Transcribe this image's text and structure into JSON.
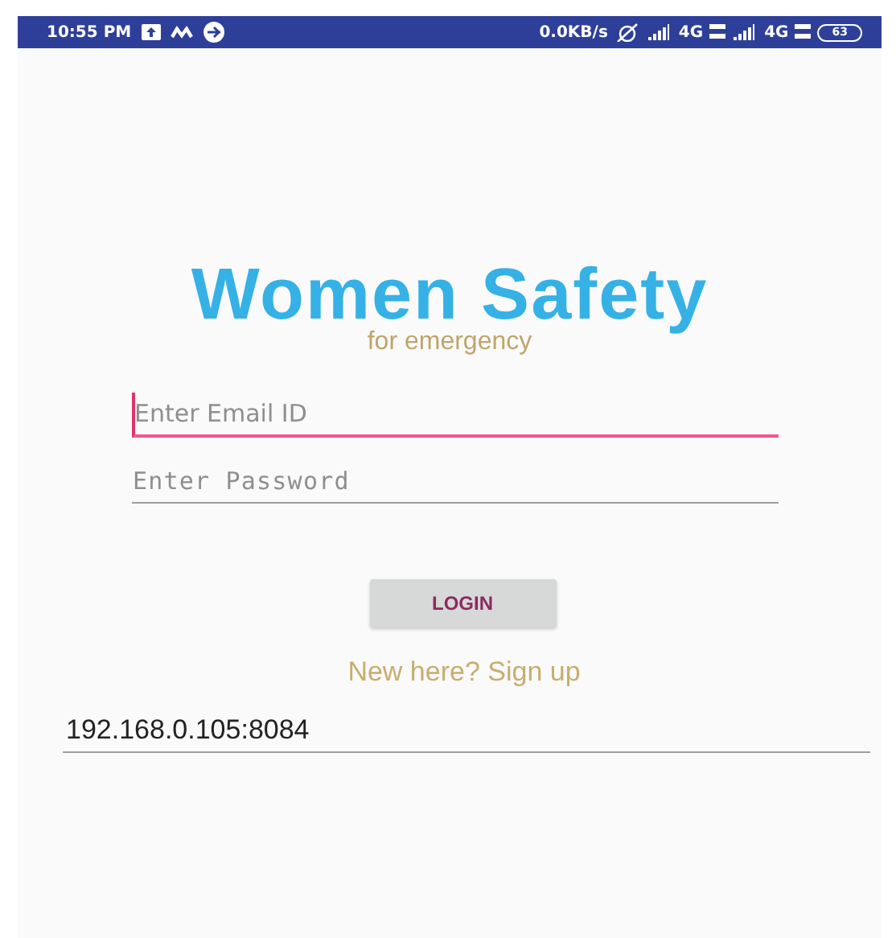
{
  "status_bar": {
    "time": "10:55 PM",
    "speed": "0.0KB/s",
    "network_1": "4G",
    "network_2": "4G",
    "battery": "63"
  },
  "app_title": "Women Safety",
  "subtitle": "for emergency",
  "fields": [
    {
      "placeholder": "Enter Email ID",
      "kind": "text",
      "focused": true
    },
    {
      "placeholder": "Enter Password",
      "kind": "password",
      "focused": false
    }
  ],
  "login_button": "LOGIN",
  "signup_link": "New here? Sign up",
  "server_field": {
    "value": "192.168.0.105:8084"
  }
}
